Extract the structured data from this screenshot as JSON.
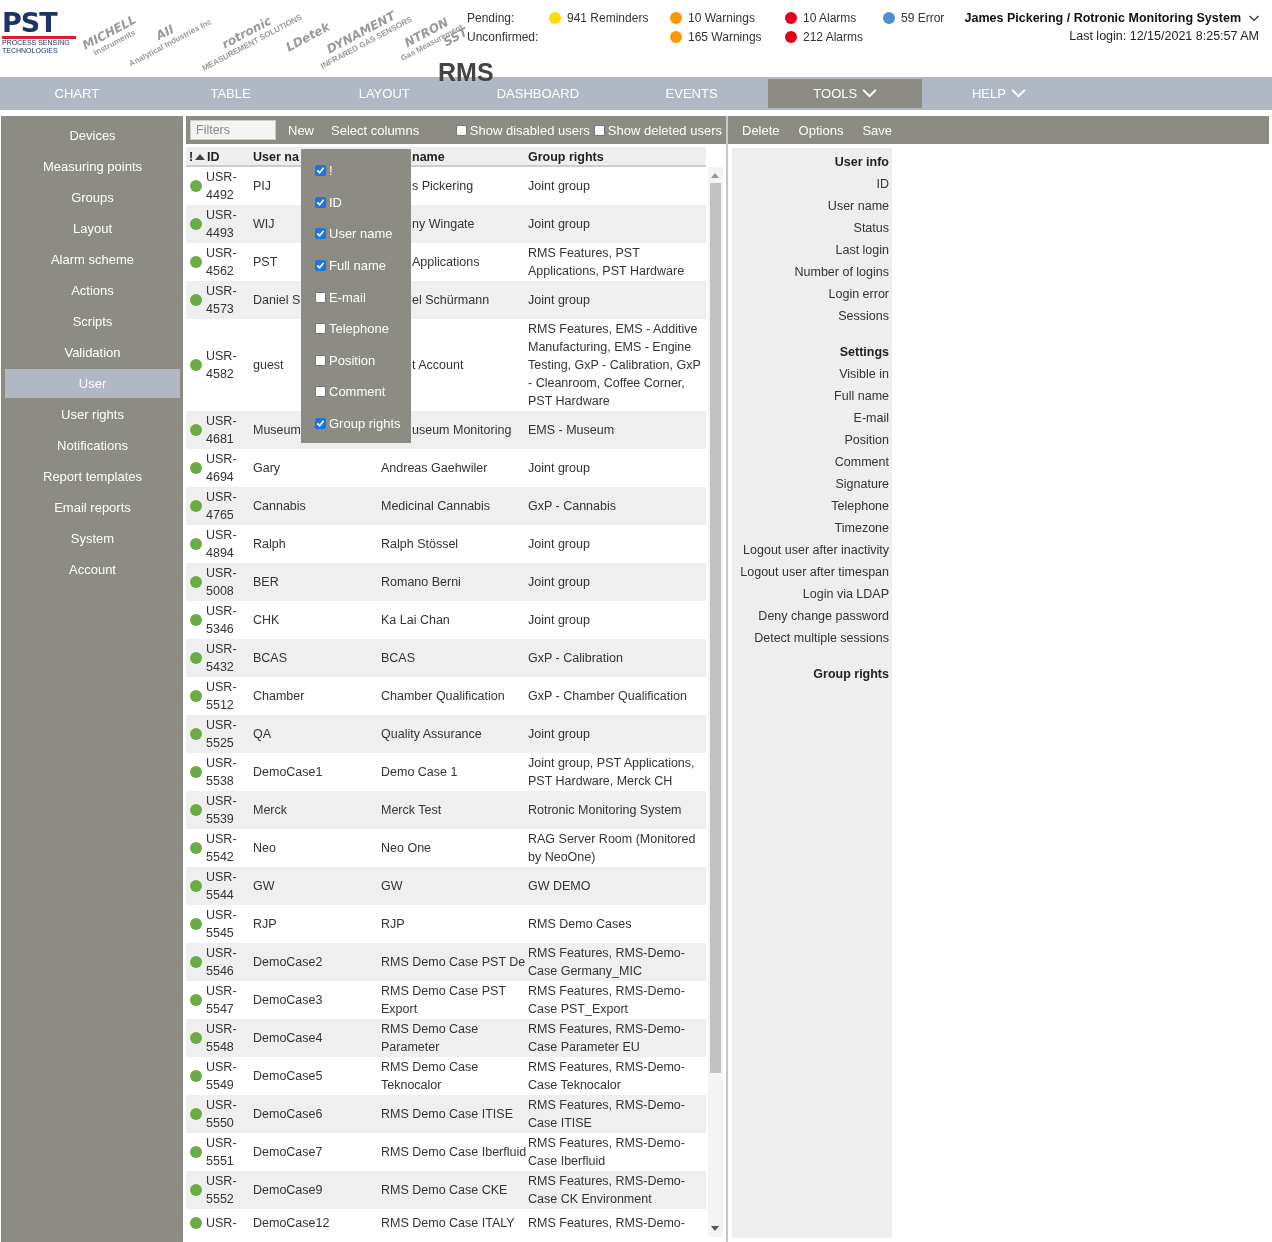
{
  "logos": [
    {
      "kind": "pst",
      "name": "PST",
      "tagline": "PROCESS SENSING",
      "tagline_2": "TECHNOLOGIES"
    },
    {
      "kind": "partner",
      "name": "MICHELL",
      "tagline": "Instruments"
    },
    {
      "kind": "partner",
      "name": "AII",
      "tagline": "Analytical Industries Inc"
    },
    {
      "kind": "partner",
      "name": "rotronic",
      "tagline": "MEASUREMENT SOLUTIONS"
    },
    {
      "kind": "partner",
      "name": "LDetek"
    },
    {
      "kind": "partner",
      "name": "DYNAMENT",
      "tagline": "INFRARED GAS SENSORS"
    },
    {
      "kind": "partner",
      "name": "NTRON",
      "tagline": "Gas Measurement"
    },
    {
      "kind": "partner",
      "name": "SST"
    }
  ],
  "app_title": "RMS",
  "notifications": {
    "labels": [
      "Pending:",
      "Unconfirmed:"
    ],
    "columns": [
      {
        "color": "#ffdd00",
        "counts": [
          "941 Reminders"
        ]
      },
      {
        "color": "#ff9500",
        "counts": [
          "10 Warnings",
          "165 Warnings"
        ]
      },
      {
        "color": "#e2001a",
        "counts": [
          "10 Alarms",
          "212 Alarms"
        ]
      },
      {
        "color": "#4f8fca",
        "counts": [
          "59 Error"
        ]
      }
    ]
  },
  "user": {
    "name": "James Pickering / Rotronic Monitoring System",
    "last_login": "Last login: 12/15/2021 8:25:57 AM"
  },
  "nav": [
    {
      "label": "CHART",
      "selected": false,
      "dropdown": false
    },
    {
      "label": "TABLE",
      "selected": false,
      "dropdown": false
    },
    {
      "label": "LAYOUT",
      "selected": false,
      "dropdown": false
    },
    {
      "label": "DASHBOARD",
      "selected": false,
      "dropdown": false
    },
    {
      "label": "EVENTS",
      "selected": false,
      "dropdown": false
    },
    {
      "label": "TOOLS",
      "selected": true,
      "dropdown": true
    },
    {
      "label": "HELP",
      "selected": false,
      "dropdown": true
    }
  ],
  "sidebar": {
    "items": [
      {
        "label": "Devices",
        "selected": false
      },
      {
        "label": "Measuring points",
        "selected": false
      },
      {
        "label": "Groups",
        "selected": false
      },
      {
        "label": "Layout",
        "selected": false
      },
      {
        "label": "Alarm scheme",
        "selected": false
      },
      {
        "label": "Actions",
        "selected": false
      },
      {
        "label": "Scripts",
        "selected": false
      },
      {
        "label": "Validation",
        "selected": false
      },
      {
        "label": "User",
        "selected": true
      },
      {
        "label": "User rights",
        "selected": false
      },
      {
        "label": "Notifications",
        "selected": false
      },
      {
        "label": "Report templates",
        "selected": false
      },
      {
        "label": "Email reports",
        "selected": false
      },
      {
        "label": "System",
        "selected": false
      },
      {
        "label": "Account",
        "selected": false
      }
    ]
  },
  "toolbar": {
    "filter": {
      "placeholder": "Filters"
    },
    "buttons": [
      "New",
      "Select columns"
    ],
    "checkboxes": [
      {
        "label": "Show disabled users",
        "checked": false
      },
      {
        "label": "Show deleted users",
        "checked": false
      }
    ]
  },
  "column_menu": [
    {
      "label": "!",
      "checked": true
    },
    {
      "label": "ID",
      "checked": true
    },
    {
      "label": "User name",
      "checked": true
    },
    {
      "label": "Full name",
      "checked": true
    },
    {
      "label": "E-mail",
      "checked": false
    },
    {
      "label": "Telephone",
      "checked": false
    },
    {
      "label": "Position",
      "checked": false
    },
    {
      "label": "Comment",
      "checked": false
    },
    {
      "label": "Group rights",
      "checked": true
    }
  ],
  "table": {
    "columns": [
      "!",
      "ID",
      "User na",
      "name",
      "Group rights"
    ],
    "rows": [
      {
        "id": "USR-4492",
        "user_name": "PIJ",
        "full_name": "s Pickering",
        "group_rights": "Joint group"
      },
      {
        "id": "USR-4493",
        "user_name": "WIJ",
        "full_name": "ny Wingate",
        "group_rights": "Joint group"
      },
      {
        "id": "USR-4562",
        "user_name": "PST",
        "full_name": "Applications",
        "group_rights": "RMS Features, PST Applications, PST Hardware"
      },
      {
        "id": "USR-4573",
        "user_name": "Daniel S",
        "full_name": "el Schürmann",
        "group_rights": "Joint group"
      },
      {
        "id": "USR-4582",
        "user_name": "guest",
        "full_name": "t Account",
        "group_rights": "RMS Features, EMS - Additive Manufacturing, EMS - Engine Testing, GxP - Calibration, GxP - Cleanroom, Coffee Corner, PST Hardware"
      },
      {
        "id": "USR-4681",
        "user_name": "Museum",
        "full_name": "useum Monitoring",
        "group_rights": "EMS - Museum"
      },
      {
        "id": "USR-4694",
        "user_name": "Gary",
        "full_name": "Andreas Gaehwiler",
        "group_rights": "Joint group"
      },
      {
        "id": "USR-4765",
        "user_name": "Cannabis",
        "full_name": "Medicinal Cannabis",
        "group_rights": "GxP - Cannabis"
      },
      {
        "id": "USR-4894",
        "user_name": "Ralph",
        "full_name": "Ralph Stössel",
        "group_rights": "Joint group"
      },
      {
        "id": "USR-5008",
        "user_name": "BER",
        "full_name": "Romano Berni",
        "group_rights": "Joint group"
      },
      {
        "id": "USR-5346",
        "user_name": "CHK",
        "full_name": "Ka Lai Chan",
        "group_rights": "Joint group"
      },
      {
        "id": "USR-5432",
        "user_name": "BCAS",
        "full_name": "BCAS",
        "group_rights": "GxP - Calibration"
      },
      {
        "id": "USR-5512",
        "user_name": "Chamber",
        "full_name": "Chamber Qualification",
        "group_rights": "GxP - Chamber Qualification"
      },
      {
        "id": "USR-5525",
        "user_name": "QA",
        "full_name": "Quality Assurance",
        "group_rights": "Joint group"
      },
      {
        "id": "USR-5538",
        "user_name": "DemoCase1",
        "full_name": "Demo Case 1",
        "group_rights": "Joint group, PST Applications, PST Hardware, Merck CH"
      },
      {
        "id": "USR-5539",
        "user_name": "Merck",
        "full_name": "Merck Test",
        "group_rights": "Rotronic Monitoring System"
      },
      {
        "id": "USR-5542",
        "user_name": "Neo",
        "full_name": "Neo One",
        "group_rights": "RAG Server Room (Monitored by NeoOne)"
      },
      {
        "id": "USR-5544",
        "user_name": "GW",
        "full_name": "GW",
        "group_rights": "GW DEMO"
      },
      {
        "id": "USR-5545",
        "user_name": "RJP",
        "full_name": "RJP",
        "group_rights": "RMS Demo Cases"
      },
      {
        "id": "USR-5546",
        "user_name": "DemoCase2",
        "full_name": "RMS Demo Case PST De",
        "group_rights": "RMS Features, RMS-Demo-Case Germany_MIC"
      },
      {
        "id": "USR-5547",
        "user_name": "DemoCase3",
        "full_name": "RMS Demo Case PST Export",
        "group_rights": "RMS Features, RMS-Demo-Case PST_Export"
      },
      {
        "id": "USR-5548",
        "user_name": "DemoCase4",
        "full_name": "RMS Demo Case Parameter",
        "group_rights": "RMS Features, RMS-Demo-Case Parameter EU"
      },
      {
        "id": "USR-5549",
        "user_name": "DemoCase5",
        "full_name": "RMS Demo Case Teknocalor",
        "group_rights": "RMS Features, RMS-Demo-Case Teknocalor"
      },
      {
        "id": "USR-5550",
        "user_name": "DemoCase6",
        "full_name": "RMS Demo Case ITISE",
        "group_rights": "RMS Features, RMS-Demo-Case ITISE"
      },
      {
        "id": "USR-5551",
        "user_name": "DemoCase7",
        "full_name": "RMS Demo Case Iberfluid",
        "group_rights": "RMS Features, RMS-Demo-Case Iberfluid"
      },
      {
        "id": "USR-5552",
        "user_name": "DemoCase9",
        "full_name": "RMS Demo Case CKE",
        "group_rights": "RMS Features, RMS-Demo-Case CK Environment"
      },
      {
        "id": "USR-",
        "user_name": "DemoCase12",
        "full_name": "RMS Demo Case ITALY",
        "group_rights": "RMS Features, RMS-Demo-"
      }
    ]
  },
  "detail": {
    "buttons": [
      "Delete",
      "Options",
      "Save"
    ],
    "sections": [
      {
        "title": "User info",
        "fields": [
          "ID",
          "User name",
          "Status",
          "Last login",
          "Number of logins",
          "Login error",
          "Sessions"
        ]
      },
      {
        "title": "Settings",
        "fields": [
          "Visible in",
          "Full name",
          "E-mail",
          "Position",
          "Comment",
          "Signature",
          "Telephone",
          "Timezone",
          "Logout user after inactivity",
          "Logout user after timespan",
          "Login via LDAP",
          "Deny change password",
          "Detect multiple sessions"
        ]
      },
      {
        "title": "Group rights"
      }
    ]
  }
}
